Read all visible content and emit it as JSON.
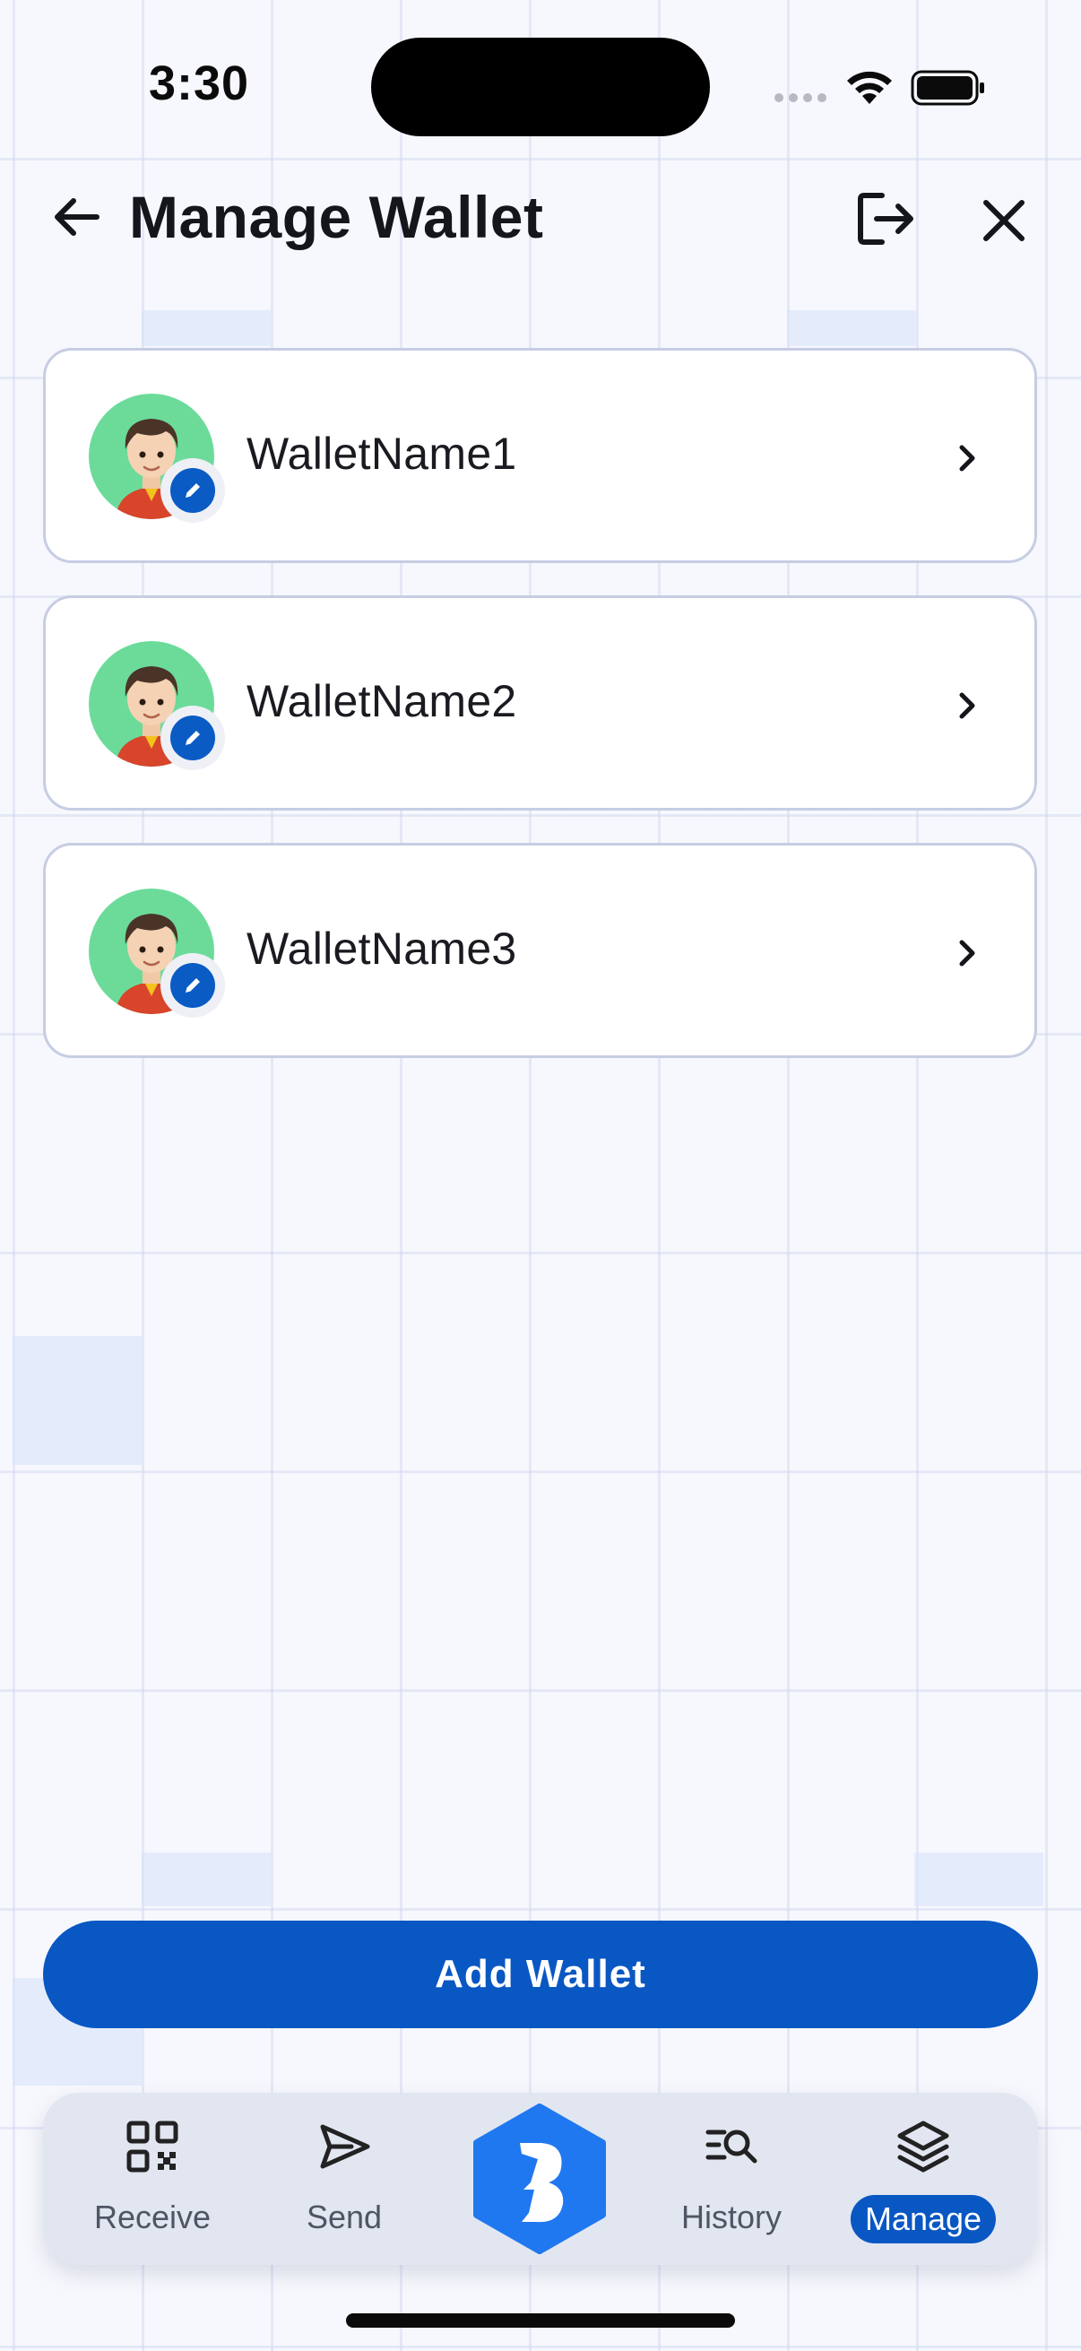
{
  "status_bar": {
    "time": "3:30",
    "icons": [
      "signal-icon",
      "wifi-icon",
      "battery-icon"
    ]
  },
  "header": {
    "title": "Manage Wallet",
    "back_icon": "arrow-left-icon",
    "logout_icon": "logout-icon",
    "close_icon": "close-icon"
  },
  "wallets": [
    {
      "name": "WalletName1"
    },
    {
      "name": "WalletName2"
    },
    {
      "name": "WalletName3"
    }
  ],
  "add_button": {
    "label": "Add Wallet"
  },
  "bottom_nav": {
    "items": [
      {
        "label": "Receive",
        "icon": "qr-code-icon",
        "active": false
      },
      {
        "label": "Send",
        "icon": "send-icon",
        "active": false
      },
      {
        "label": "",
        "icon": "app-logo-icon",
        "active": false
      },
      {
        "label": "History",
        "icon": "history-search-icon",
        "active": false
      },
      {
        "label": "Manage",
        "icon": "layers-icon",
        "active": true
      }
    ]
  },
  "colors": {
    "primary": "#0957c2",
    "card_border": "#c6cde3",
    "background": "#f7f8fd",
    "avatar_bg": "#6cdb9a",
    "nav_bg": "#e2e6f1",
    "logo_blue": "#1f78f0"
  }
}
